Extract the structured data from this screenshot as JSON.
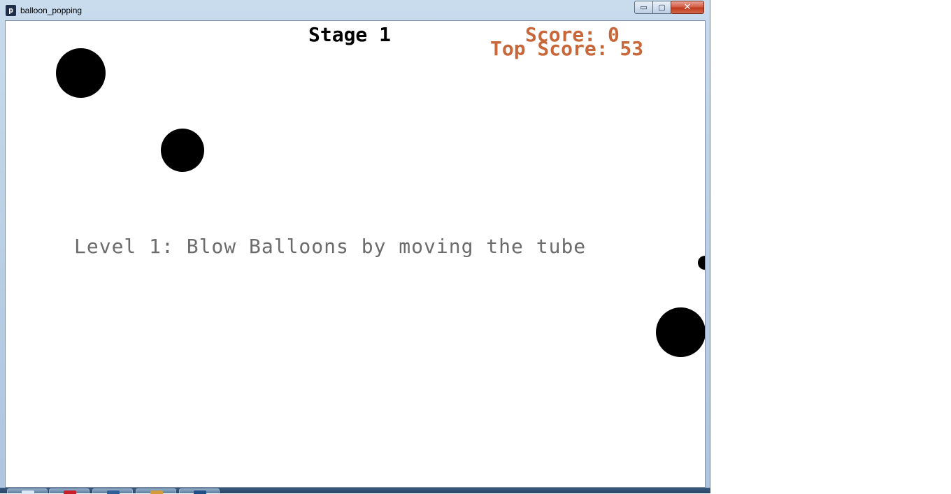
{
  "window": {
    "title": "balloon_popping",
    "app_icon_glyph": "p",
    "controls": {
      "minimize_icon": "minimize-icon",
      "maximize_icon": "maximize-icon",
      "close_icon": "close-icon",
      "minimize_glyph": "▭",
      "maximize_glyph": "▢",
      "close_glyph": "✕"
    }
  },
  "game": {
    "stage_label": "Stage 1",
    "score_label": "Score: 0",
    "top_score_label": "Top Score: 53",
    "message": "Level 1: Blow Balloons by moving the tube",
    "balloon_color": "#000000",
    "score_color": "#c8683a",
    "message_color": "#6b6b6b"
  },
  "taskbar": {
    "items": [
      {
        "icon": "explorer-icon",
        "color": "#dbe8f5"
      },
      {
        "icon": "pdf-reader-icon",
        "color": "#c8202a"
      },
      {
        "icon": "app-icon",
        "color": "#2f5f96"
      },
      {
        "icon": "media-player-icon",
        "color": "#d59a3a"
      },
      {
        "icon": "processing-icon",
        "color": "#1f4f86"
      }
    ]
  }
}
